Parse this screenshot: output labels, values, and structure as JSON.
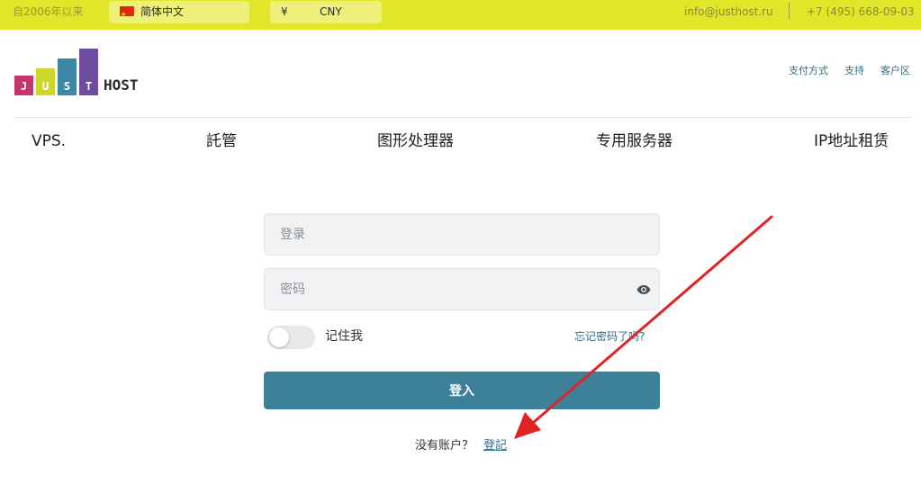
{
  "topbar": {
    "since": "自2006年以来",
    "language": "简体中文",
    "currency_symbol": "¥",
    "currency": "CNY",
    "email": "info@justhost.ru",
    "phone": "+7 (495) 668-09-03"
  },
  "logo": {
    "letters": [
      "J",
      "U",
      "S",
      "T"
    ],
    "host": "HOST"
  },
  "header_links": [
    "支付方式",
    "支持",
    "客户区"
  ],
  "nav": [
    "VPS.",
    "託管",
    "图形处理器",
    "专用服务器",
    "IP地址租赁"
  ],
  "form": {
    "login_placeholder": "登录",
    "password_placeholder": "密码",
    "remember_label": "记住我",
    "forgot_label": "忘记密码了吗?",
    "submit_label": "登入",
    "no_account_text": "没有账户？",
    "register_label": "登記"
  },
  "colors": {
    "topbar": "#e1e628",
    "accent": "#3d8099",
    "annotation_arrow": "#e02424"
  },
  "icons": [
    "china-flag-icon",
    "eye-icon"
  ]
}
